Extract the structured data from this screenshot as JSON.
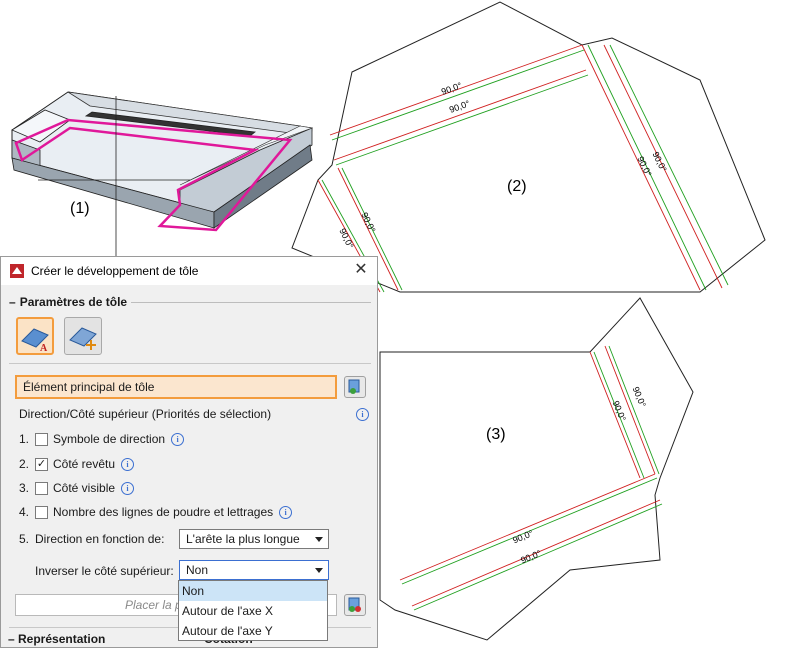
{
  "labels": {
    "part1": "(1)",
    "part2": "(2)",
    "part3": "(3)"
  },
  "angles": {
    "a1": "90,0°",
    "a2": "90,0°",
    "a3": "90,0°",
    "a4": "90,0°",
    "a5": "90,0°",
    "a6": "90,0°",
    "a7": "90,0°",
    "a8": "90,0°",
    "a9": "90,0°",
    "a10": "90,0°"
  },
  "dialog": {
    "title": "Créer le développement de tôle",
    "section_sheet": "Paramètres de tôle",
    "primary_field": "Élément principal de tôle",
    "direction_header": "Direction/Côté supérieur (Priorités de sélection)",
    "options": [
      {
        "num": "1.",
        "label": "Symbole de direction",
        "checked": false
      },
      {
        "num": "2.",
        "label": "Côté revêtu",
        "checked": true
      },
      {
        "num": "3.",
        "label": "Côté visible",
        "checked": false
      },
      {
        "num": "4.",
        "label": "Nombre des lignes de poudre et lettrages",
        "checked": false
      }
    ],
    "direction_num": "5.",
    "direction_label": "Direction en fonction de:",
    "direction_value": "L'arête la plus longue",
    "invert_label": "Inverser le côté supérieur:",
    "invert_value": "Non",
    "invert_options": [
      "Non",
      "Autour de l'axe X",
      "Autour de l'axe Y"
    ],
    "project_placeholder": "Placer la projection",
    "section_representation": "Représentation",
    "section_cotation": "Cotation"
  },
  "colors": {
    "accent": "#f39c3d",
    "accent_bg": "#fbe3c6",
    "bend_red": "#d02020",
    "bend_green": "#20a020",
    "outline_magenta": "#e0189a"
  }
}
